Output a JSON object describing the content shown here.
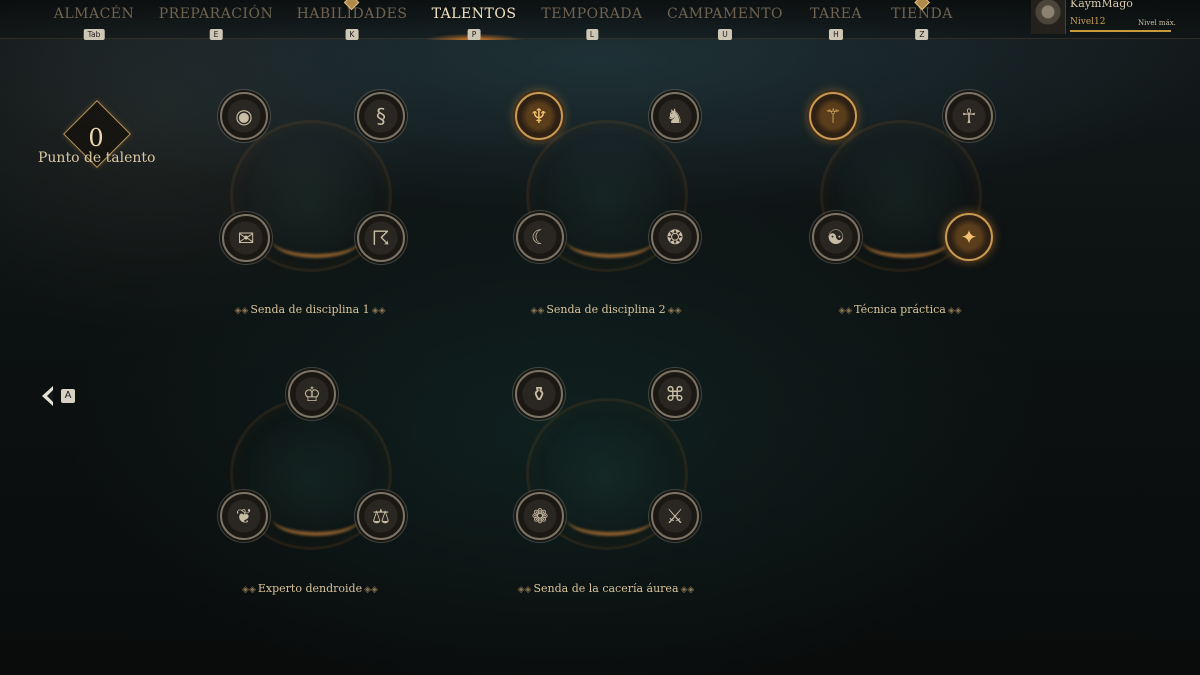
{
  "nav": {
    "tabs": [
      {
        "label": "ALMACÉN",
        "key": "Tab"
      },
      {
        "label": "PREPARACIÓN",
        "key": "E"
      },
      {
        "label": "HABILIDADES",
        "key": "K"
      },
      {
        "label": "TALENTOS",
        "key": "P"
      },
      {
        "label": "TEMPORADA",
        "key": "L"
      },
      {
        "label": "CAMPAMENTO",
        "key": "U"
      },
      {
        "label": "TAREA",
        "key": "H"
      },
      {
        "label": "TIENDA",
        "key": "Z"
      }
    ],
    "active_tab": "TALENTOS"
  },
  "profile": {
    "name": "KaymMago",
    "level": "Nivel12",
    "max_note": "Nivel máx."
  },
  "talent_points": {
    "value": "0",
    "label": "Punto de talento"
  },
  "back": {
    "key": "A"
  },
  "groups": [
    {
      "title": "Senda de disciplina 1",
      "nodes": [
        {
          "icon": "eye-icon",
          "active": false
        },
        {
          "icon": "serpent-icon",
          "active": false
        },
        {
          "icon": "scroll-icon",
          "active": false
        },
        {
          "icon": "runner-icon",
          "active": false
        }
      ]
    },
    {
      "title": "Senda de disciplina 2",
      "nodes": [
        {
          "icon": "meditating-figure-icon",
          "active": true
        },
        {
          "icon": "serpent-rider-icon",
          "active": false
        },
        {
          "icon": "feather-icon",
          "active": false
        },
        {
          "icon": "beast-head-icon",
          "active": false
        }
      ]
    },
    {
      "title": "Técnica práctica",
      "nodes": [
        {
          "icon": "warrior-staff-icon",
          "active": true
        },
        {
          "icon": "figure-icon",
          "active": false
        },
        {
          "icon": "meditation-icon",
          "active": false
        },
        {
          "icon": "dash-strike-icon",
          "active": true
        }
      ]
    },
    {
      "title": "Experto dendroide",
      "nodes": [
        {
          "icon": "masked-face-icon",
          "active": false
        },
        {
          "icon": "leaf-flame-icon",
          "active": false
        },
        {
          "icon": "scales-icon",
          "active": false
        }
      ]
    },
    {
      "title": "Senda de la cacería áurea",
      "nodes": [
        {
          "icon": "sealed-vial-icon",
          "active": false
        },
        {
          "icon": "knot-icon",
          "active": false
        },
        {
          "icon": "shell-icon",
          "active": false
        },
        {
          "icon": "blades-icon",
          "active": false
        }
      ]
    }
  ]
}
